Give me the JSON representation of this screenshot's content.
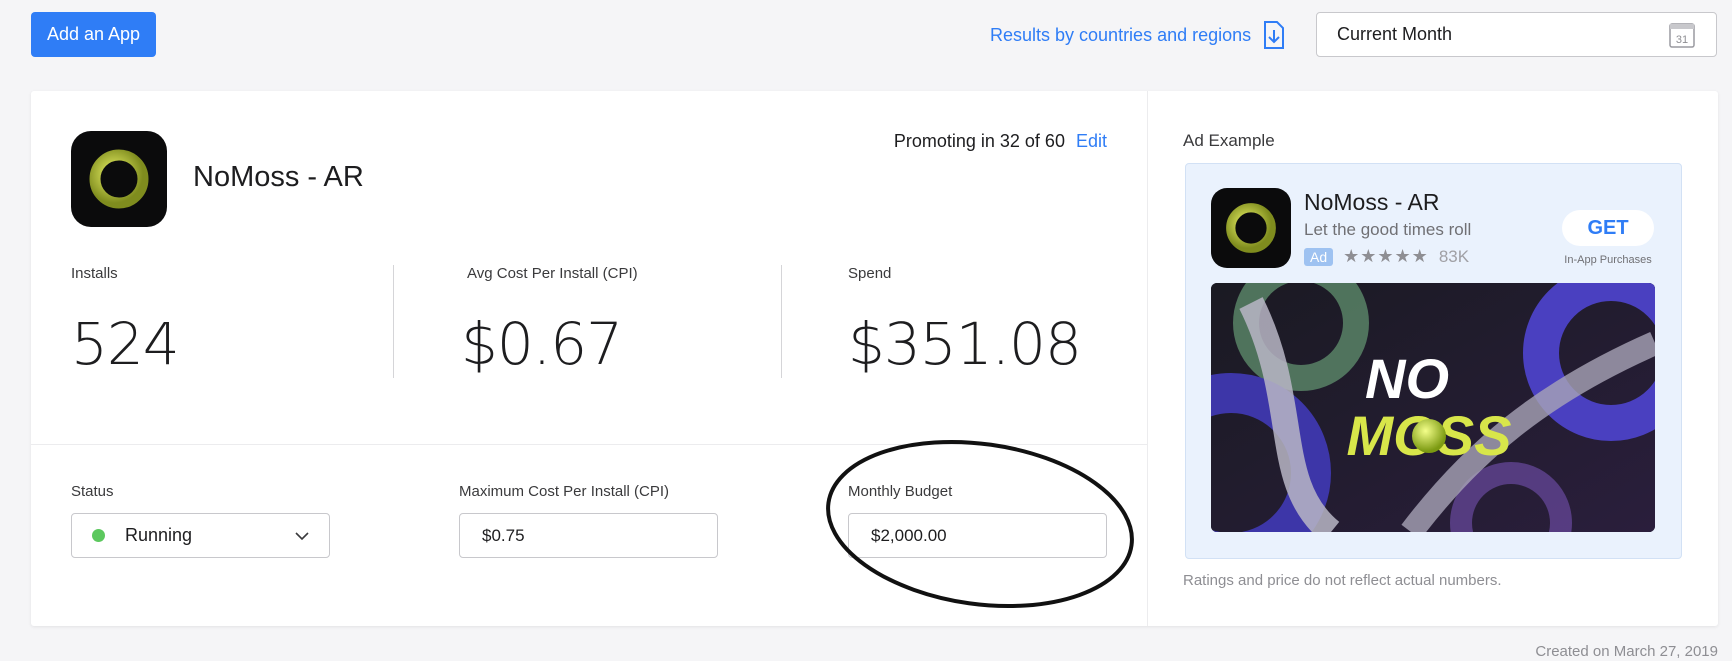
{
  "toolbar": {
    "add_app_label": "Add an App",
    "results_link": "Results by countries and regions",
    "date_range": "Current Month",
    "calendar_day": "31"
  },
  "app": {
    "name": "NoMoss - AR",
    "promoting_text": "Promoting in 32 of 60",
    "edit_label": "Edit"
  },
  "metrics": [
    {
      "label": "Installs",
      "value": "524"
    },
    {
      "label": "Avg Cost Per Install (CPI)",
      "value": "$0.67"
    },
    {
      "label": "Spend",
      "value": "$351.08"
    }
  ],
  "settings": {
    "status_label": "Status",
    "status_value": "Running",
    "status_color": "#5cc85e",
    "max_cpi_label": "Maximum Cost Per Install (CPI)",
    "max_cpi_value": "$0.75",
    "budget_label": "Monthly Budget",
    "budget_value": "$2,000.00"
  },
  "ad_example": {
    "title": "Ad Example",
    "app_name": "NoMoss - AR",
    "tagline": "Let the good times roll",
    "badge": "Ad",
    "stars": "★★★★★",
    "rating_count": "83K",
    "get_label": "GET",
    "iap_note": "In-App Purchases",
    "banner_line1": "NO",
    "banner_line2": "MOSS",
    "disclaimer": "Ratings and price do not reflect actual numbers."
  },
  "footer": {
    "created": "Created on March 27, 2019"
  },
  "colors": {
    "accent": "#2f7df6",
    "brand_lime": "#d8e64a"
  }
}
